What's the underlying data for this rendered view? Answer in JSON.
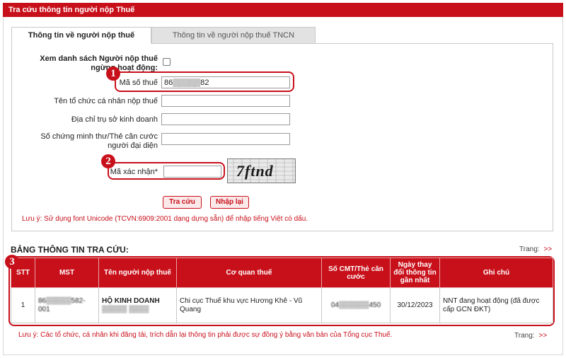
{
  "page_title": "Tra cứu thông tin người nộp Thuế",
  "tabs": [
    {
      "label": "Thông tin về người nộp thuế"
    },
    {
      "label": "Thông tin về người nộp thuế TNCN"
    }
  ],
  "form": {
    "inactive_label": "Xem danh sách Người nộp thuế ngừng hoạt động:",
    "tax_code_label": "Mã số thuế",
    "tax_code_value": "86▒▒▒▒▒82",
    "org_name_label": "Tên tổ chức cá nhân nộp thuế",
    "org_name_value": "",
    "address_label": "Địa chỉ trụ sở kinh doanh",
    "address_value": "",
    "id_label": "Số chứng minh thư/Thẻ căn cước người đại diện",
    "id_value": "",
    "captcha_label": "Mã xác nhận*",
    "captcha_value": "",
    "captcha_image_text": "7ftnd",
    "search_button": "Tra cứu",
    "reset_button": "Nhập lại",
    "unicode_note": "Lưu ý: Sử dụng font Unicode (TCVN:6909:2001 dạng dựng sẵn) để nhập tiếng Việt có dấu."
  },
  "annotations": [
    "1",
    "2",
    "3"
  ],
  "results": {
    "title": "BẢNG THÔNG TIN TRA CỨU:",
    "pager_label": "Trang:",
    "pager_arrow": ">>",
    "columns": [
      "STT",
      "MST",
      "Tên người nộp thuế",
      "Cơ quan thuế",
      "Số CMT/Thẻ căn cước",
      "Ngày thay đổi thông tin gần nhất",
      "Ghi chú"
    ],
    "rows": [
      {
        "stt": "1",
        "mst": "86▒▒▒▒▒582-001",
        "name_line1": "HỘ KINH DOANH",
        "name_line2": "▒▒▒▒▒ ▒▒▒▒",
        "agency": "Chi cục Thuế khu vực Hương Khê - Vũ Quang",
        "id_no": "04▒▒▒▒▒▒450",
        "date": "30/12/2023",
        "note": "NNT đang hoạt động (đã được cấp GCN ĐKT)"
      }
    ],
    "footer_note": "Lưu ý: Các tổ chức, cá nhân khi đăng tải, trích dẫn lại thông tin phải được sự đồng ý bằng văn bản của Tổng cục Thuế.",
    "footer_pager_label": "Trang:",
    "footer_pager_arrow": ">>"
  },
  "colors": {
    "accent": "#c8101a",
    "tab_inactive": "#e2e2e2"
  }
}
